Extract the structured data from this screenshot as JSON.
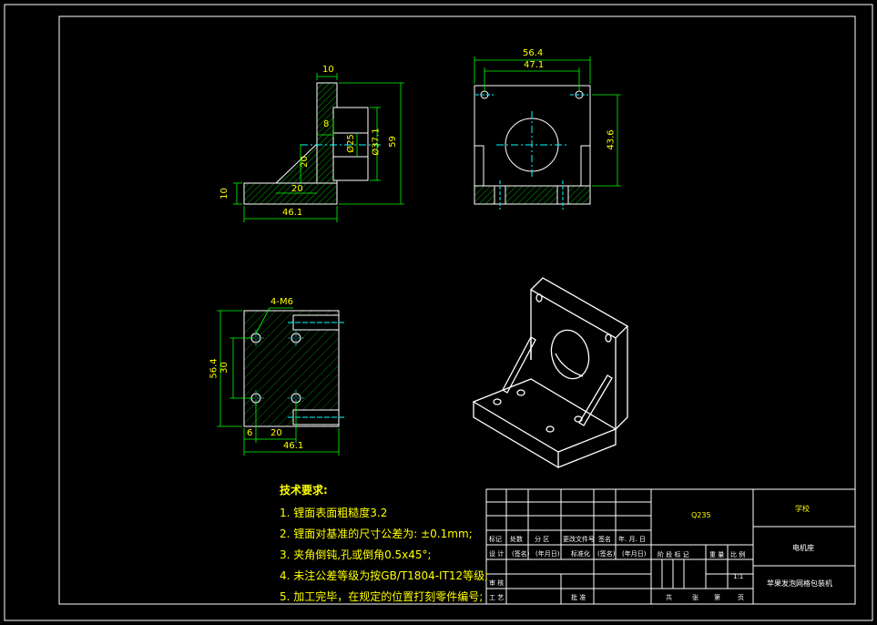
{
  "colors": {
    "background": "#000000",
    "outline": "#ffffff",
    "dimension": "#00ff00",
    "dimension_text": "#ffff00",
    "centerline": "#00ffff",
    "hatch": "#00aa00",
    "frame": "#ffffff"
  },
  "front_view": {
    "dims": {
      "top_width": "10",
      "height": "59",
      "bore_dia": "Ø25",
      "boss_dia": "Ø37.1",
      "small_width": "8",
      "rib_vertical": "20",
      "rib_horizontal": "20",
      "base_thickness": "10",
      "base_length": "46.1"
    }
  },
  "side_view": {
    "dims": {
      "outer_width": "56.4",
      "hole_spacing": "47.1",
      "height": "43.6"
    }
  },
  "top_view": {
    "dims": {
      "holes": "4-M6",
      "outer_height": "56.4",
      "hole_spacing_v": "30",
      "offset": "6",
      "hole_spacing_h": "20",
      "length": "46.1"
    }
  },
  "tech_notes": {
    "title": "技术要求:",
    "items": [
      "1. 锂面表面粗糙度3.2",
      "2. 锂面对基准的尺寸公差为: ±0.1mm;",
      "3. 夹角倒钝,孔或倒角0.5x45°;",
      "4. 未注公差等级为按GB/T1804-IT12等级;",
      "5. 加工完毕，在规定的位置打刻零件编号;"
    ]
  },
  "title_block": {
    "material": "Q235",
    "school": "学校",
    "part_name": "电机座",
    "project": "苹果发泡网格包装机",
    "scale": "1:1",
    "labels": {
      "mark": "标记",
      "count": "处数",
      "zone": "分 区",
      "change_doc": "更改文件号",
      "sign": "签名",
      "date": "年. 月. 日",
      "design": "设 计",
      "sign2": "(签名)",
      "date2": "(年月日)",
      "standardize": "标准化",
      "sign3": "(签名)",
      "date3": "(年月日)",
      "stage": "阶 段 标 记",
      "weight": "重 量",
      "ratio": "比 例",
      "review": "审 核",
      "process": "工 艺",
      "approve": "批 准",
      "total": "共",
      "sheets": "张",
      "page_no": "第",
      "page": "页"
    }
  }
}
